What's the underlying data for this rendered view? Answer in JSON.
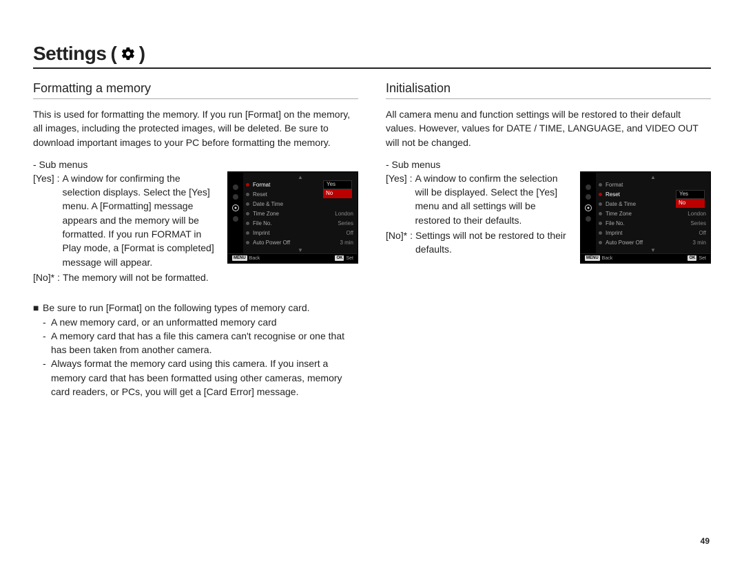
{
  "page_title": "Settings",
  "page_title_paren_open": "(",
  "page_title_paren_close": ")",
  "page_number": "49",
  "left": {
    "heading": "Formatting a memory",
    "intro": "This is used for formatting the memory. If you run [Format] on the memory, all images, including the protected images, will be deleted. Be sure to download important images to your PC before formatting the memory.",
    "sub_label": "- Sub menus",
    "yes_key": "[Yes]",
    "yes_val": "A window for confirming the selection displays. Select the [Yes] menu. A [Formatting] message appears and the memory will be formatted. If you run FORMAT in Play mode, a [Format is completed] message will appear.",
    "no_key": "[No]*",
    "no_val": "The memory will not be formatted.",
    "note_lead": "Be sure to run [Format] on the following types of memory card.",
    "note_items": [
      "A new memory card, or an unformatted memory card",
      "A memory card that has a file this camera can't recognise or one that has been taken from another camera.",
      "Always format the memory card using this camera. If you insert a memory card that has been formatted using other cameras, memory card readers, or PCs, you will get a [Card Error] message."
    ]
  },
  "right": {
    "heading": "Initialisation",
    "intro": "All camera menu and function settings will be restored to their default values. However, values for DATE / TIME, LANGUAGE, and VIDEO OUT will not be changed.",
    "sub_label": "- Sub menus",
    "yes_key": "[Yes]",
    "yes_val": "A window to confirm the selection will be displayed. Select the [Yes] menu and all settings will be restored to their defaults.",
    "no_key": "[No]*",
    "no_val": "Settings will not be restored to their defaults."
  },
  "cam": {
    "rows": [
      {
        "label": "Format",
        "value": ""
      },
      {
        "label": "Reset",
        "value": ""
      },
      {
        "label": "Date & Time",
        "value": ""
      },
      {
        "label": "Time Zone",
        "value": "London"
      },
      {
        "label": "File No.",
        "value": "Series"
      },
      {
        "label": "Imprint",
        "value": "Off"
      },
      {
        "label": "Auto Power Off",
        "value": "3 min"
      }
    ],
    "opt_yes": "Yes",
    "opt_no": "No",
    "footer_back_key": "MENU",
    "footer_back": "Back",
    "footer_set_key": "OK",
    "footer_set": "Set"
  },
  "cam_left_selected_index": 0,
  "cam_right_selected_index": 1
}
